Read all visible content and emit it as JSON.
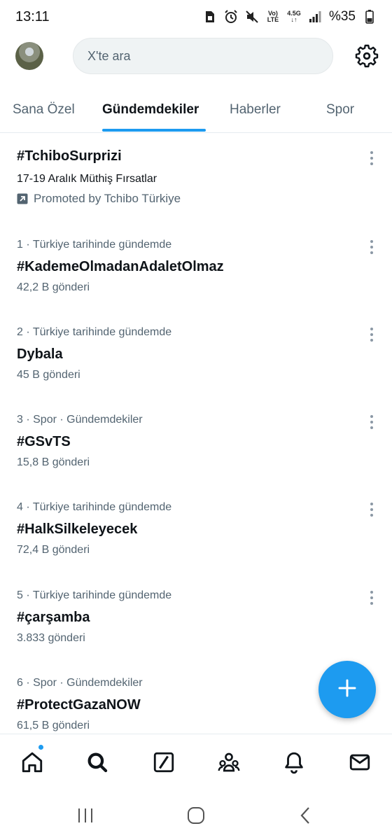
{
  "status_bar": {
    "time": "13:11",
    "network_small_top": "Vo)",
    "network_small_bottom": "LTE",
    "speed_label": "4.5G",
    "battery": "%35"
  },
  "top_bar": {
    "search_placeholder": "X'te ara"
  },
  "tabs": [
    {
      "label": "Sana Özel",
      "active": false
    },
    {
      "label": "Gündemdekiler",
      "active": true
    },
    {
      "label": "Haberler",
      "active": false
    },
    {
      "label": "Spor",
      "active": false
    }
  ],
  "promoted": {
    "title": "#TchiboSurprizi",
    "description": "17-19 Aralık Müthiş Fırsatlar",
    "promoted_by": "Promoted by Tchibo Türkiye"
  },
  "trends": [
    {
      "meta": "1 · Türkiye tarihinde gündemde",
      "title": "#KademeOlmadanAdaletOlmaz",
      "posts": "42,2 B gönderi"
    },
    {
      "meta": "2 · Türkiye tarihinde gündemde",
      "title": "Dybala",
      "posts": "45 B gönderi"
    },
    {
      "meta": "3 · Spor · Gündemdekiler",
      "title": "#GSvTS",
      "posts": "15,8 B gönderi"
    },
    {
      "meta": "4 · Türkiye tarihinde gündemde",
      "title": "#HalkSilkeleyecek",
      "posts": "72,4 B gönderi"
    },
    {
      "meta": "5 · Türkiye tarihinde gündemde",
      "title": "#çarşamba",
      "posts": "3.833 gönderi"
    },
    {
      "meta": "6 · Spor · Gündemdekiler",
      "title": "#ProtectGazaNOW",
      "posts": "61,5 B gönderi"
    }
  ],
  "bottom_nav": [
    "home-icon",
    "search-icon",
    "grok-icon",
    "communities-icon",
    "notifications-icon",
    "messages-icon"
  ],
  "colors": {
    "accent": "#1d9bf0",
    "text": "#0f1419",
    "secondary": "#536471"
  }
}
